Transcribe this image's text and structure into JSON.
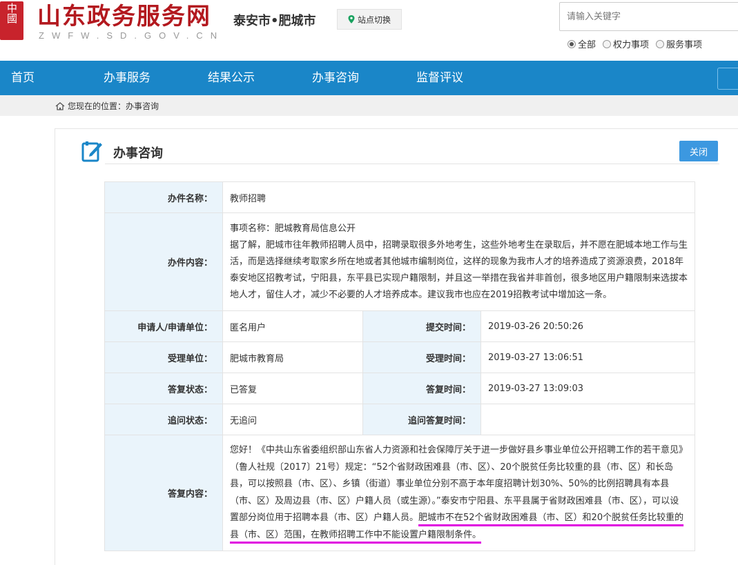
{
  "header": {
    "seal_text": "中國",
    "site_title": "山东政务服务网",
    "site_domain": "ZWFW.SD.GOV.CN",
    "city": "泰安市•肥城市",
    "switch_label": "站点切换",
    "pin_icon": "location-pin-icon",
    "search_placeholder": "请输入关键字",
    "radios": [
      {
        "label": "全部",
        "checked": true
      },
      {
        "label": "权力事项",
        "checked": false
      },
      {
        "label": "服务事项",
        "checked": false
      }
    ]
  },
  "nav": {
    "items": [
      "首页",
      "办事服务",
      "结果公示",
      "办事咨询",
      "监督评议"
    ]
  },
  "breadcrumb": {
    "text": "您现在的位置：办事咨询"
  },
  "panel": {
    "title": "办事咨询",
    "close_label": "关闭"
  },
  "table": {
    "name_label": "办件名称：",
    "name_value": "教师招聘",
    "content_label": "办件内容：",
    "content_lines": [
      "事项名称：肥城教育局信息公开",
      "据了解，肥城市往年教师招聘人员中，招聘录取很多外地考生，这些外地考生在录取后，并不愿在肥城本地工作与生活，而是选择继续考取家乡所在地或者其他城市编制岗位，这样的现象为我市人才的培养造成了资源浪费，2018年泰安地区招教考试，宁阳县，东平县已实现户籍限制，并且这一举措在我省并非首创，很多地区用户籍限制来选拔本地人才，留住人才，减少不必要的人才培养成本。建议我市也应在2019招教考试中增加这一条。"
    ],
    "applicant_label": "申请人/申请单位：",
    "applicant_value": "匿名用户",
    "submit_time_label": "提交时间：",
    "submit_time_value": "2019-03-26 20:50:26",
    "accept_unit_label": "受理单位：",
    "accept_unit_value": "肥城市教育局",
    "accept_time_label": "受理时间：",
    "accept_time_value": "2019-03-27 13:06:51",
    "reply_status_label": "答复状态：",
    "reply_status_value": "已答复",
    "reply_time_label": "答复时间：",
    "reply_time_value": "2019-03-27 13:09:03",
    "followup_status_label": "追问状态：",
    "followup_status_value": "无追问",
    "followup_reply_time_label": "追问答复时间：",
    "followup_reply_time_value": "",
    "reply_label": "答复内容：",
    "reply_main": "您好！《中共山东省委组织部山东省人力资源和社会保障厅关于进一步做好县乡事业单位公开招聘工作的若干意见》（鲁人社规〔2017〕21号）规定：“52个省财政困难县（市、区）、20个脱贫任务比较重的县（市、区）和长岛县，可以按照县（市、区）、乡镇（街道）事业单位分别不高于本年度招聘计划30%、50%的比例招聘具有本县（市、区）及周边县（市、区）户籍人员（或生源）。”泰安市宁阳县、东平县属于省财政困难县（市、区），可以设置部分岗位用于招聘本县（市、区）户籍人员。",
    "reply_highlight": "肥城市不在52个省财政困难县（市、区）和20个脱贫任务比较重的县（市、区）范围，在教师招聘工作中不能设置户籍限制条件。",
    "highlight_color": "#e000e0"
  }
}
